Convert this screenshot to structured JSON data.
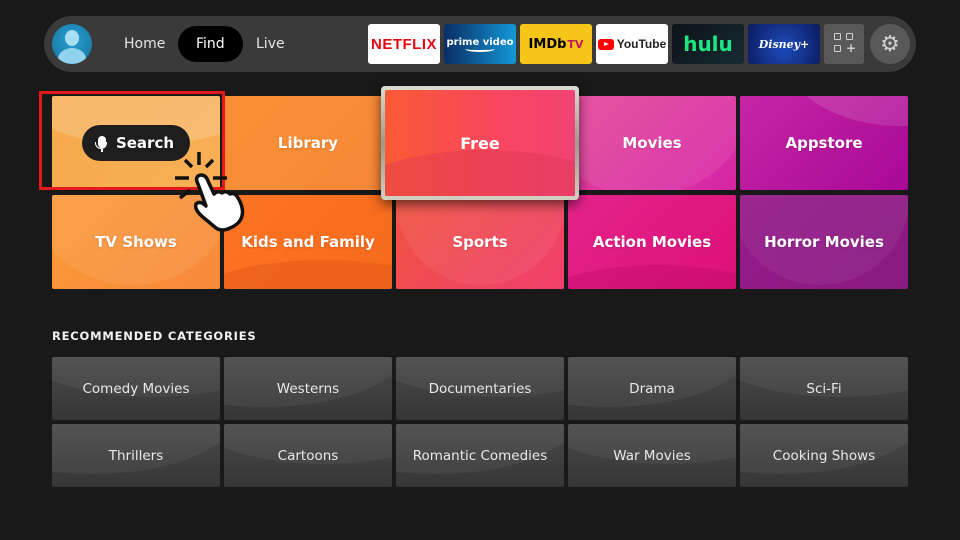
{
  "nav": {
    "profile": "profile-avatar",
    "tabs": [
      {
        "label": "Home",
        "active": false
      },
      {
        "label": "Find",
        "active": true
      },
      {
        "label": "Live",
        "active": false
      }
    ],
    "apps": [
      {
        "name": "Netflix",
        "label": "NETFLIX"
      },
      {
        "name": "Prime Video",
        "label": "prime video"
      },
      {
        "name": "IMDb TV",
        "label": "IMDb",
        "suffix": "TV"
      },
      {
        "name": "YouTube",
        "label": "YouTube"
      },
      {
        "name": "Hulu",
        "label": "hulu"
      },
      {
        "name": "Disney+",
        "label": "Disney+"
      }
    ],
    "apps_grid_icon": "apps-grid-add-icon",
    "settings_icon": "gear-icon"
  },
  "categories": [
    {
      "label": "Search",
      "icon": "microphone-icon",
      "highlighted": true
    },
    {
      "label": "Library"
    },
    {
      "label": "Free",
      "focused": true
    },
    {
      "label": "Movies"
    },
    {
      "label": "Appstore"
    },
    {
      "label": "TV Shows"
    },
    {
      "label": "Kids and Family"
    },
    {
      "label": "Sports"
    },
    {
      "label": "Action Movies"
    },
    {
      "label": "Horror Movies"
    }
  ],
  "recommended": {
    "title": "RECOMMENDED CATEGORIES",
    "items": [
      "Comedy Movies",
      "Westerns",
      "Documentaries",
      "Drama",
      "Sci-Fi",
      "Thrillers",
      "Cartoons",
      "Romantic Comedies",
      "War Movies",
      "Cooking Shows"
    ]
  },
  "colors": {
    "background": "#191919",
    "navbar": "#3a3a3a",
    "highlight_box": "#e3191c",
    "netflix_red": "#e50914",
    "hulu_green": "#1ce783",
    "imdb_yellow": "#f5c518"
  }
}
